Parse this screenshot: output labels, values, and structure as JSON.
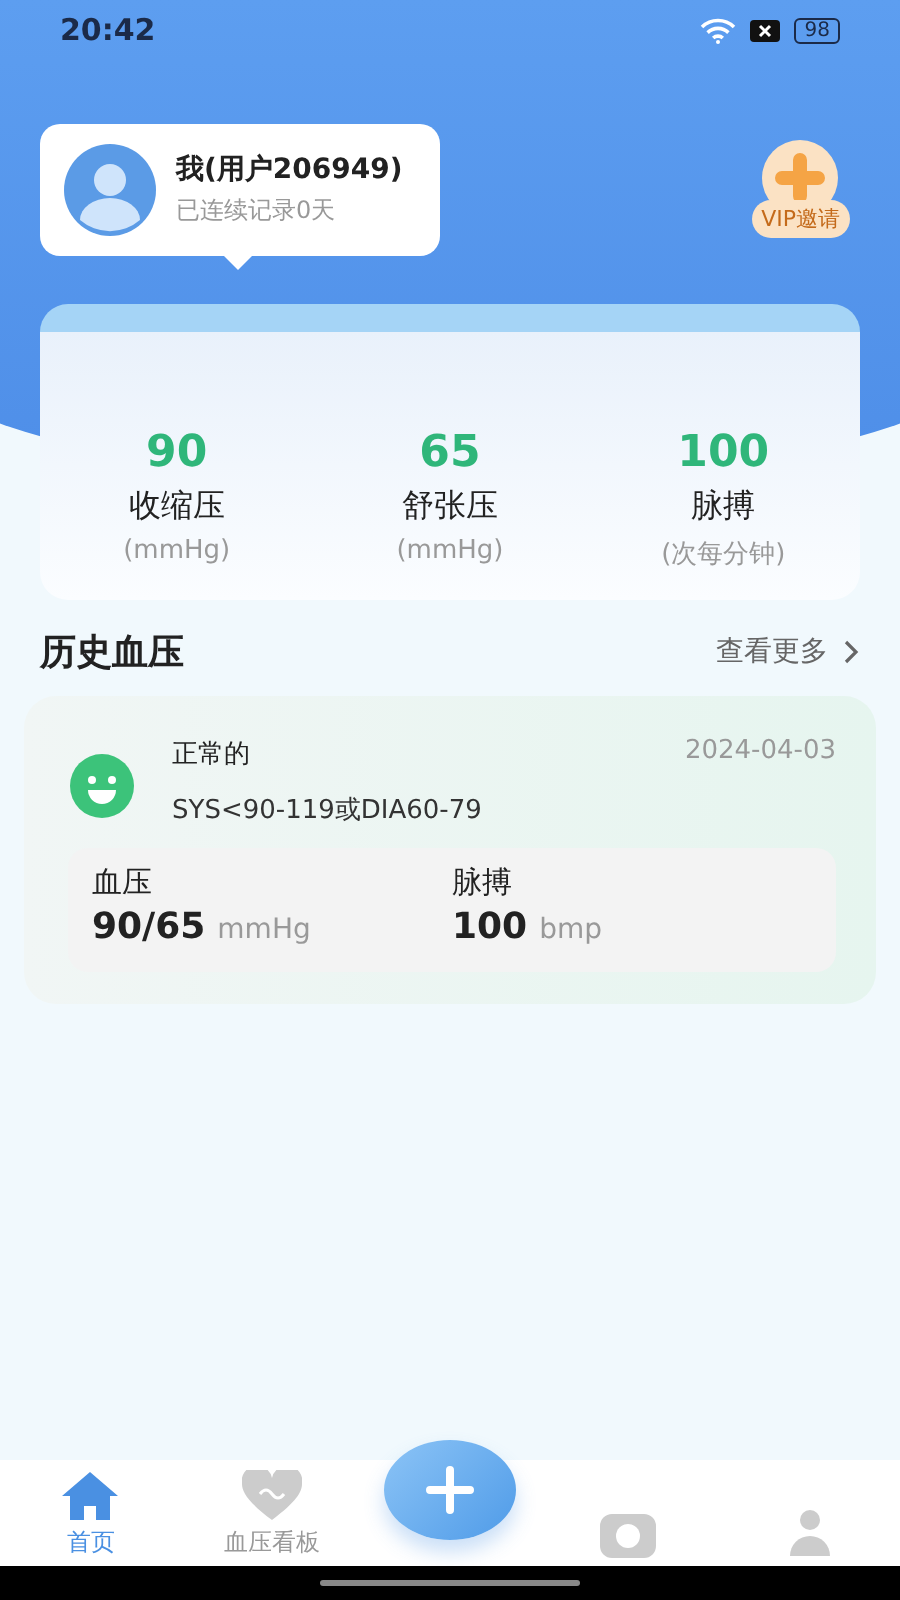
{
  "status_bar": {
    "time": "20:42",
    "battery": "98"
  },
  "profile": {
    "name": "我(用户206949)",
    "streak": "已连续记录0天"
  },
  "vip": {
    "label": "VIP邀请"
  },
  "stats": [
    {
      "value": "90",
      "label": "收缩压",
      "unit": "(mmHg)"
    },
    {
      "value": "65",
      "label": "舒张压",
      "unit": "(mmHg)"
    },
    {
      "value": "100",
      "label": "脉搏",
      "unit": "(次每分钟)"
    }
  ],
  "history": {
    "title": "历史血压",
    "more": "查看更多",
    "records": [
      {
        "status": "正常的",
        "date": "2024-04-03",
        "range": "SYS<90-119或DIA60-79",
        "color": "#3cc37a",
        "bp_label": "血压",
        "bp_value": "90/65",
        "bp_unit": "mmHg",
        "pulse_label": "脉搏",
        "pulse_value": "100",
        "pulse_unit": "bmp"
      }
    ]
  },
  "tabs": [
    {
      "kind": "home",
      "label": "首页",
      "selected": true
    },
    {
      "kind": "heart",
      "label": "血压看板",
      "selected": false
    },
    {
      "kind": "add"
    },
    {
      "kind": "camera",
      "selected": false
    },
    {
      "kind": "person",
      "selected": false
    }
  ]
}
